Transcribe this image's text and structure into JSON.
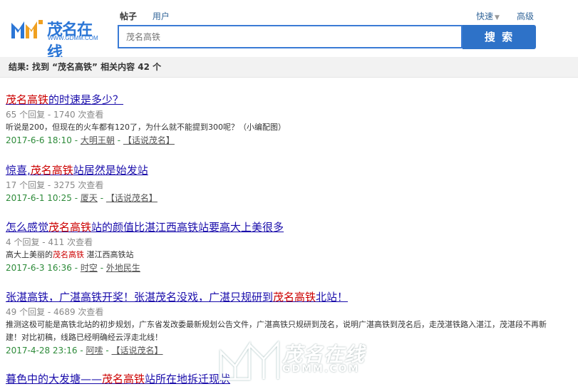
{
  "logo": {
    "name": "茂名在线",
    "url": "WWW.GDMM.COM"
  },
  "tabs": [
    {
      "label": "帖子"
    },
    {
      "label": "用户"
    }
  ],
  "quick": {
    "label": "快速"
  },
  "advanced": {
    "label": "高级"
  },
  "search": {
    "placeholder": "茂名高铁",
    "button_label": "搜 索"
  },
  "result_summary": "结果: 找到 “茂名高铁” 相关内容 42 个",
  "results": [
    {
      "title_pre": "",
      "title_hl": "茂名高铁",
      "title_post": "的时速是多少？",
      "stats": "65 个回复 - 1740 次查看",
      "snippet_pre": "听说是200，但现在的火车都有120了，为什么就不能提到300呢？（小编配图）",
      "snippet_hl": "",
      "snippet_post": "",
      "date": "2017-6-6 18:10",
      "author": "大明王朝",
      "forum": "【话说茂名】"
    },
    {
      "title_pre": "惊喜,",
      "title_hl": "茂名高铁",
      "title_post": "站居然是始发站",
      "stats": "17 个回复 - 3275 次查看",
      "snippet_pre": "",
      "snippet_hl": "",
      "snippet_post": "",
      "date": "2017-6-1 10:25",
      "author": "厦天",
      "forum": "【话说茂名】"
    },
    {
      "title_pre": "怎么感觉",
      "title_hl": "茂名高铁",
      "title_post": "站的颜值比湛江西高铁站要高大上美很多",
      "stats": "4 个回复 - 411 次查看",
      "snippet_pre": "高大上美丽的",
      "snippet_hl": "茂名高铁",
      "snippet_post": " 湛江西高铁站",
      "date": "2017-6-3 16:36",
      "author": "时空",
      "forum": "外地民生"
    },
    {
      "title_pre": "张湛高铁，广湛高铁开奖！张湛茂名没戏，广湛只规研到",
      "title_hl": "茂名高铁",
      "title_post": "北站！",
      "stats": "49 个回复 - 4689 次查看",
      "snippet_pre": "推测这极可能是高铁北站的初步规划，广东省发改委最新规划公告文件，广湛高铁只规研到茂名，说明广湛高铁到茂名后，走茂湛铁路入湛江，茂湛段不再新建！对比初稿，线路已经明确经云浮走北线！",
      "snippet_hl": "",
      "snippet_post": "",
      "date": "2017-4-28 23:16",
      "author": "阿嗦",
      "forum": "【话说茂名】"
    },
    {
      "title_pre": "暮色中的大发塘——",
      "title_hl": "茂名高铁",
      "title_post": "站所在地拆迁现状",
      "stats": "",
      "snippet_pre": "",
      "snippet_hl": "",
      "snippet_post": "",
      "date": "",
      "author": "",
      "forum": ""
    }
  ],
  "watermark": {
    "name": "茂名在线",
    "url": "GDMM.COM"
  },
  "colors": {
    "link": "#1a0dab",
    "highlight": "#cc0000",
    "meta_green": "#2e8b3a",
    "search_blue": "#2e72c8"
  }
}
